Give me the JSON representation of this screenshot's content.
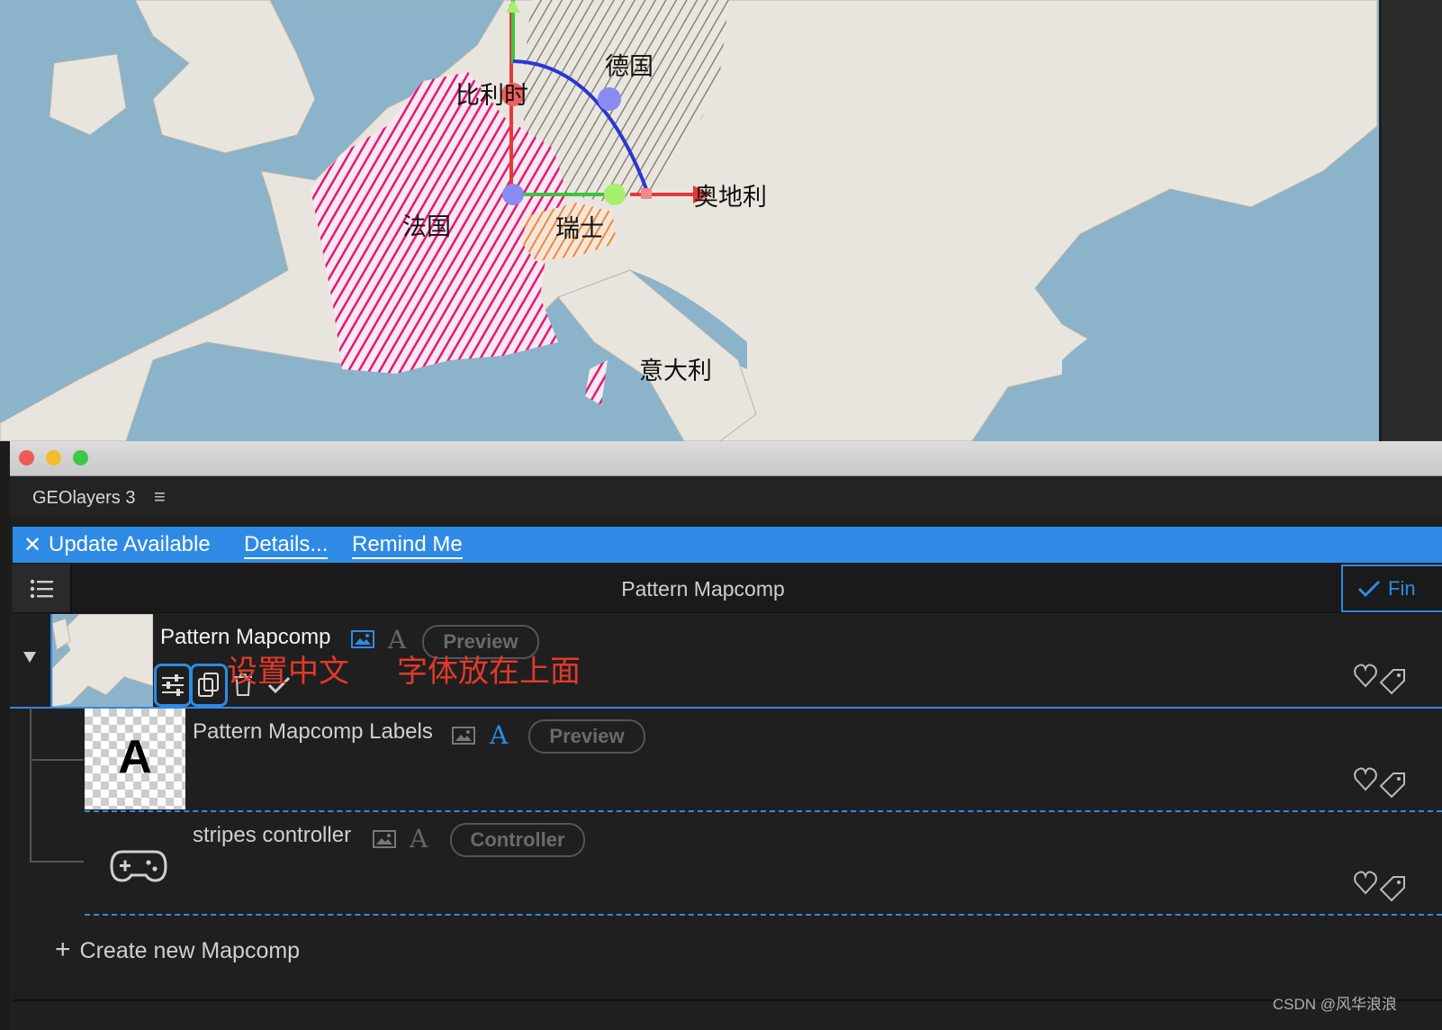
{
  "map": {
    "labels": {
      "germany": "德国",
      "belgium": "比利时",
      "france": "法国",
      "switzerland": "瑞士",
      "austria": "奥地利",
      "italy": "意大利"
    },
    "colors": {
      "sea": "#8bb3c9",
      "land": "#e8e5df",
      "france_stripe": "#e8157a",
      "germany_stripe": "#8a8576",
      "swiss_stripe": "#f0883c"
    }
  },
  "panel": {
    "title": "GEOlayers 3",
    "menu_icon": "hamburger-icon"
  },
  "update_bar": {
    "close": "✕",
    "text": "Update Available",
    "details": "Details...",
    "remind": "Remind Me",
    "color": "#2f8ae5"
  },
  "toolbar": {
    "title": "Pattern Mapcomp",
    "finish": "Fin"
  },
  "rows": [
    {
      "name": "Pattern Mapcomp",
      "badge": "Preview",
      "annotation_1": "设置中文",
      "annotation_2": "字体放在上面"
    },
    {
      "name": "Pattern Mapcomp Labels",
      "badge": "Preview",
      "thumb_letter": "A"
    },
    {
      "name": "stripes controller",
      "badge": "Controller"
    }
  ],
  "create": {
    "label": "Create new Mapcomp"
  },
  "watermark": "CSDN @风华浪浪"
}
